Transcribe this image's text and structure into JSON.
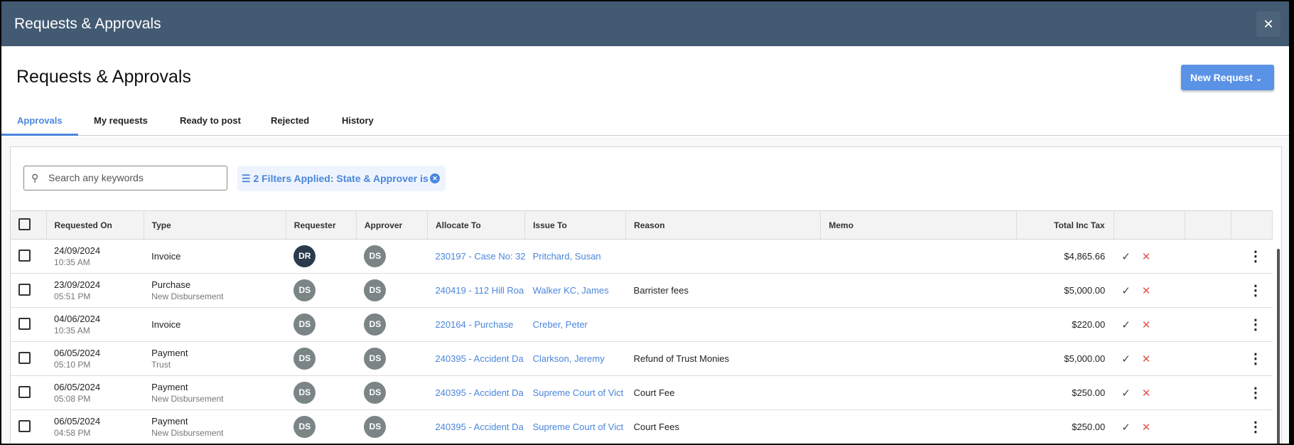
{
  "window": {
    "title": "Requests & Approvals",
    "close_icon": "close-icon"
  },
  "page": {
    "heading": "Requests & Approvals",
    "new_request": "New Request"
  },
  "tabs": [
    {
      "label": "Approvals",
      "active": true
    },
    {
      "label": "My requests"
    },
    {
      "label": "Ready to post"
    },
    {
      "label": "Rejected"
    },
    {
      "label": "History"
    }
  ],
  "search": {
    "placeholder": "Search any keywords"
  },
  "filter": {
    "label": "2 Filters Applied: State & Approver is"
  },
  "columns": [
    "Requested On",
    "Type",
    "Requester",
    "Approver",
    "Allocate To",
    "Issue To",
    "Reason",
    "Memo",
    "Total Inc Tax"
  ],
  "rows": [
    {
      "date": "24/09/2024",
      "time": "10:35 AM",
      "type": "Invoice",
      "subtype": "",
      "requester": "DR",
      "approver": "DS",
      "allocate": "230197 - Case No: 32",
      "issue": "Pritchard, Susan",
      "reason": "",
      "memo": "",
      "total": "$4,865.66"
    },
    {
      "date": "23/09/2024",
      "time": "05:51 PM",
      "type": "Purchase",
      "subtype": "New Disbursement",
      "requester": "DS",
      "approver": "DS",
      "allocate": "240419 - 112 Hill Roa",
      "issue": "Walker KC, James",
      "reason": "Barrister fees",
      "memo": "",
      "total": "$5,000.00"
    },
    {
      "date": "04/06/2024",
      "time": "10:35 AM",
      "type": "Invoice",
      "subtype": "",
      "requester": "DS",
      "approver": "DS",
      "allocate": "220164 - Purchase",
      "issue": "Creber, Peter",
      "reason": "",
      "memo": "",
      "total": "$220.00"
    },
    {
      "date": "06/05/2024",
      "time": "05:10 PM",
      "type": "Payment",
      "subtype": "Trust",
      "requester": "DS",
      "approver": "DS",
      "allocate": "240395 - Accident Da",
      "issue": "Clarkson, Jeremy",
      "reason": "Refund of Trust Monies",
      "memo": "",
      "total": "$5,000.00"
    },
    {
      "date": "06/05/2024",
      "time": "05:08 PM",
      "type": "Payment",
      "subtype": "New Disbursement",
      "requester": "DS",
      "approver": "DS",
      "allocate": "240395 - Accident Da",
      "issue": "Supreme Court of Vict",
      "reason": "Court Fee",
      "memo": "",
      "total": "$250.00"
    },
    {
      "date": "06/05/2024",
      "time": "04:58 PM",
      "type": "Payment",
      "subtype": "New Disbursement",
      "requester": "DS",
      "approver": "DS",
      "allocate": "240395 - Accident Da",
      "issue": "Supreme Court of Vict",
      "reason": "Court Fees",
      "memo": "",
      "total": "$250.00"
    }
  ],
  "colors": {
    "titlebar": "#435a73",
    "accent": "#4a86dc",
    "reject": "#e5534b"
  }
}
